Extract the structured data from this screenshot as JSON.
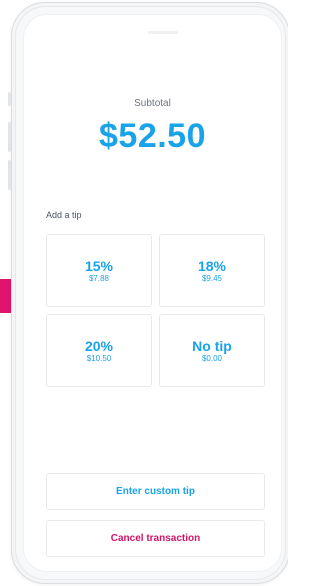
{
  "subtotal": {
    "label": "Subtotal",
    "amount": "$52.50"
  },
  "tip_section": {
    "label": "Add a tip",
    "options": [
      {
        "percent": "15%",
        "amount": "$7.88"
      },
      {
        "percent": "18%",
        "amount": "$9.45"
      },
      {
        "percent": "20%",
        "amount": "$10.50"
      },
      {
        "percent": "No tip",
        "amount": "$0.00"
      }
    ]
  },
  "actions": {
    "custom_tip_label": "Enter custom tip",
    "cancel_label": "Cancel transaction"
  },
  "colors": {
    "accent": "#1aa3e8",
    "danger": "#d01468",
    "side_tab": "#e0136d"
  }
}
